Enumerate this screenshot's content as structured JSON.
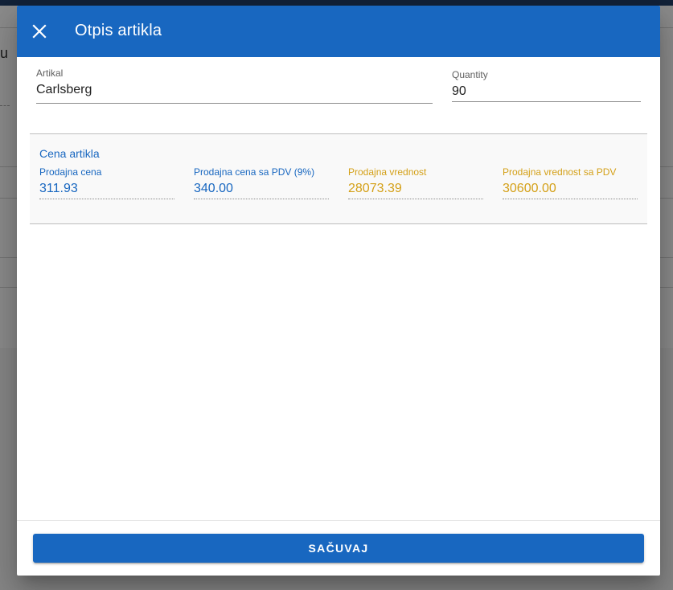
{
  "background": {
    "fragment_text": "u"
  },
  "dialog": {
    "title": "Otpis artikla",
    "close_icon": "close-icon"
  },
  "form": {
    "artikal": {
      "label": "Artikal",
      "value": "Carlsberg"
    },
    "quantity": {
      "label": "Quantity",
      "value": "90"
    }
  },
  "price_section": {
    "title": "Cena artikla",
    "fields": [
      {
        "label": "Prodajna cena",
        "value": "311.93",
        "color": "#1867c0"
      },
      {
        "label": "Prodajna cena sa PDV (9%)",
        "value": "340.00",
        "color": "#1867c0"
      },
      {
        "label": "Prodajna vrednost",
        "value": "28073.39",
        "color": "#d4a017"
      },
      {
        "label": "Prodajna vrednost sa PDV",
        "value": "30600.00",
        "color": "#d4a017"
      }
    ]
  },
  "footer": {
    "save_label": "SAČUVAJ"
  },
  "colors": {
    "primary": "#1867c0",
    "accent_gold": "#d4a017"
  }
}
